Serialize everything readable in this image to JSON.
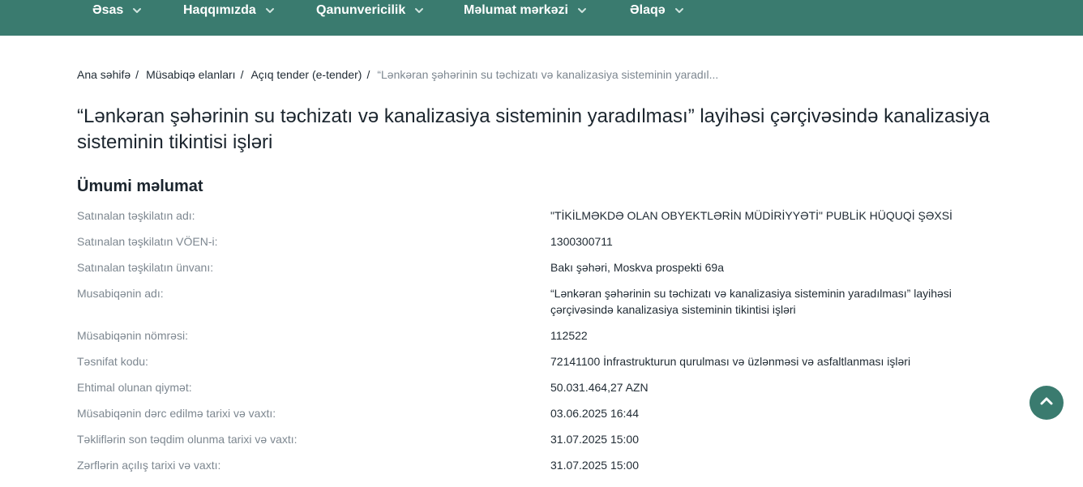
{
  "nav": {
    "items": [
      {
        "label": "Əsas"
      },
      {
        "label": "Haqqımızda"
      },
      {
        "label": "Qanunvericilik"
      },
      {
        "label": "Məlumat mərkəzi"
      },
      {
        "label": "Əlaqə"
      }
    ]
  },
  "breadcrumb": {
    "items": [
      "Ana səhifə",
      "Müsabiqə elanları",
      "Açıq tender (e-tender)"
    ],
    "separator": "/",
    "current": "“Lənkəran şəhərinin su təchizatı və kanalizasiya sisteminin yaradıl..."
  },
  "page_title": "“Lənkəran şəhərinin su təchizatı və kanalizasiya sisteminin yaradılması” layihəsi çərçivəsində kanalizasiya sisteminin tikintisi işləri",
  "section_title": "Ümumi məlumat",
  "info": [
    {
      "label": "Satınalan təşkilatın adı:",
      "value": "\"TİKİLMƏKDƏ OLAN OBYEKTLƏRİN MÜDİRİYYƏTİ\" PUBLİK HÜQUQİ ŞƏXSİ"
    },
    {
      "label": "Satınalan təşkilatın VÖEN-i:",
      "value": "1300300711"
    },
    {
      "label": "Satınalan təşkilatın ünvanı:",
      "value": "Bakı şəhəri, Moskva prospekti 69a"
    },
    {
      "label": "Musabiqənin adı:",
      "value": "“Lənkəran şəhərinin su təchizatı və kanalizasiya sisteminin yaradılması” layihəsi çərçivəsində kanalizasiya sisteminin tikintisi işləri"
    },
    {
      "label": "Müsabiqənin nömrəsi:",
      "value": "112522"
    },
    {
      "label": "Təsnifat kodu:",
      "value": "72141100 İnfrastrukturun qurulması və üzlənməsi və asfaltlanması işləri"
    },
    {
      "label": "Ehtimal olunan qiymət:",
      "value": "50.031.464,27 AZN"
    },
    {
      "label": "Müsabiqənin dərc edilmə tarixi və vaxtı:",
      "value": "03.06.2025 16:44"
    },
    {
      "label": "Təkliflərin son təqdim olunma tarixi və vaxtı:",
      "value": "31.07.2025 15:00"
    },
    {
      "label": "Zərflərin açılış tarixi və vaxtı:",
      "value": "31.07.2025 15:00"
    }
  ],
  "icons": {
    "nav_chevron": "chevron-down-icon",
    "scroll_top": "chevron-up-icon"
  },
  "colors": {
    "brand": "#3a7b6f",
    "muted_text": "#7d8790",
    "text": "#1f2a33"
  }
}
